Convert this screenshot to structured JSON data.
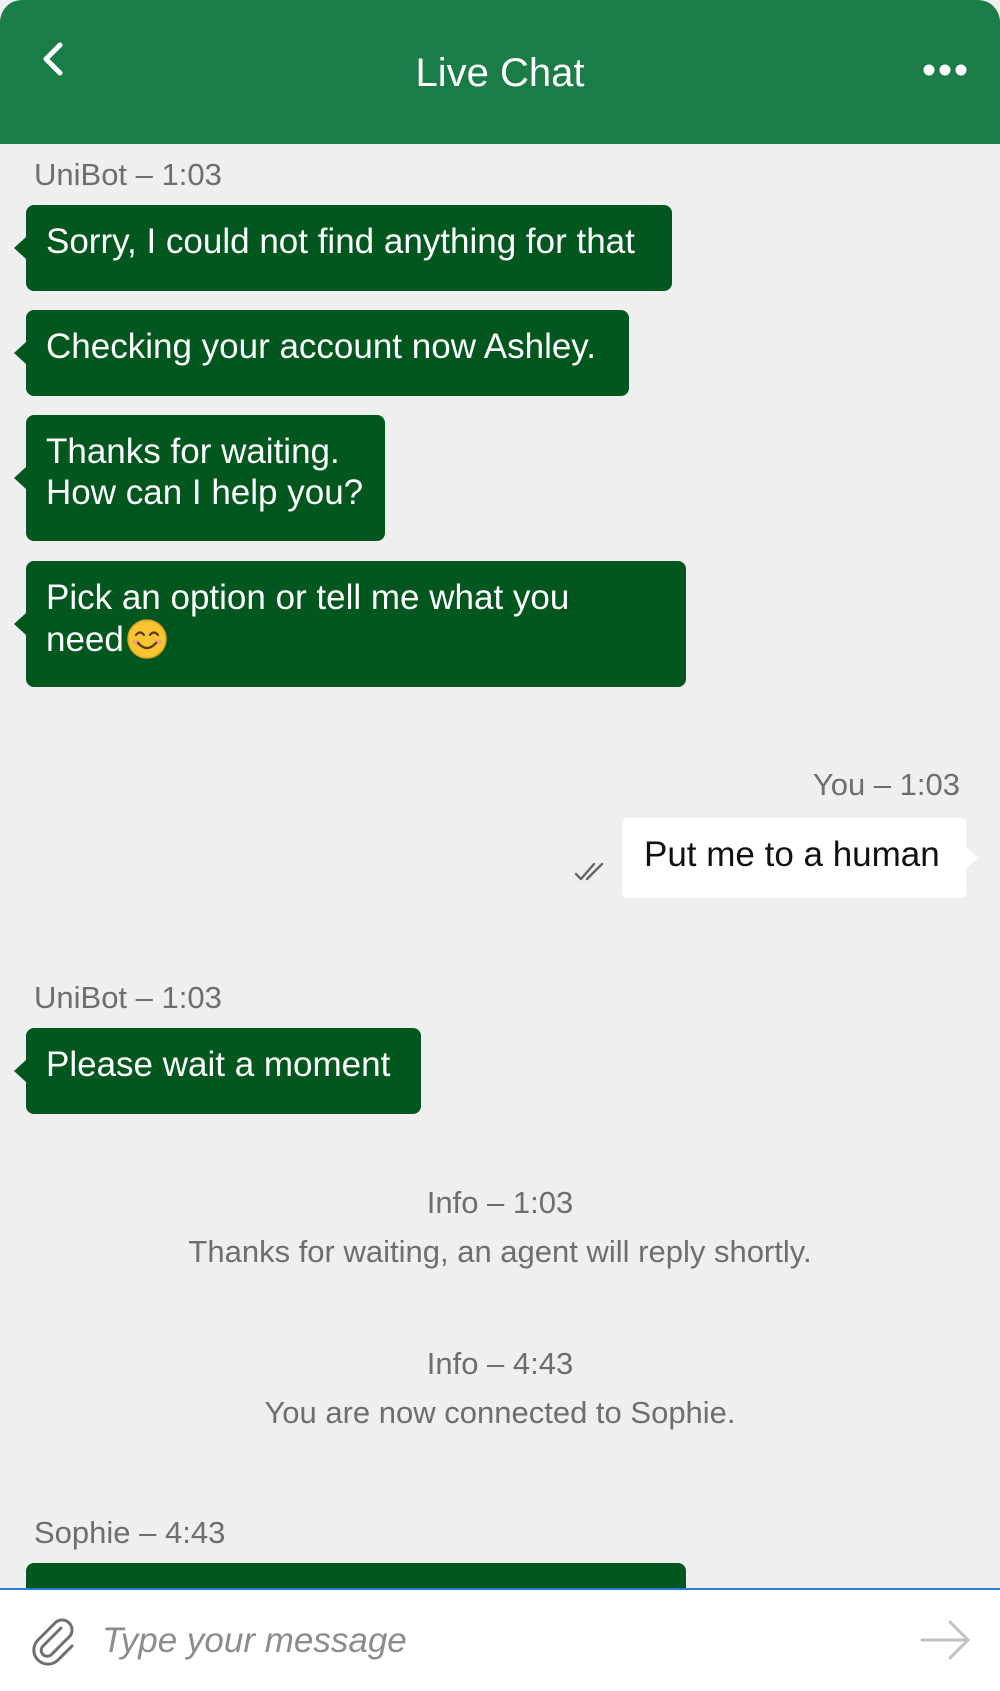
{
  "header": {
    "title": "Live Chat",
    "back_icon": "chevron-left-icon",
    "more_icon": "more-horizontal-icon"
  },
  "colors": {
    "header_bg": "#1a7c47",
    "bot_bubble": "#02571f",
    "user_bubble": "#ffffff",
    "chat_bg": "#efefef",
    "input_border": "#2a7fd6"
  },
  "messages": {
    "group1_meta": "UniBot – 1:03",
    "bot1": "Sorry, I could not find anything for that",
    "bot2": "Checking your account now Ashley.",
    "bot3": "Thanks for waiting.\nHow can I help you?",
    "bot4": "Pick an option or tell me what you\nneed",
    "bot4_emoji": "smiling-face-emoji",
    "user_meta": "You – 1:03",
    "user1": "Put me to a human",
    "user1_status_icon": "double-check-icon",
    "group2_meta": "UniBot – 1:03",
    "bot5": "Please wait a moment",
    "info1_meta": "Info – 1:03",
    "info1_text": "Thanks for waiting, an agent will reply shortly.",
    "info2_meta": "Info – 4:43",
    "info2_text": "You are now connected to Sophie.",
    "agent_meta": "Sophie – 4:43"
  },
  "composer": {
    "placeholder": "Type your message",
    "attach_icon": "paperclip-icon",
    "send_icon": "arrow-right-icon"
  }
}
